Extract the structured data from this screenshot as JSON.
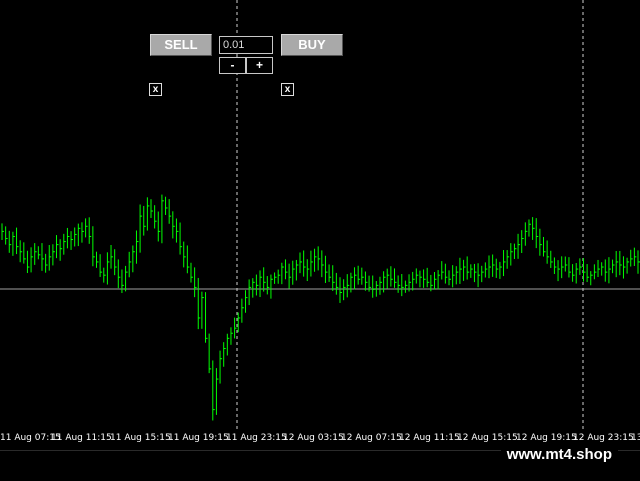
{
  "panel": {
    "sell_label": "SELL",
    "buy_label": "BUY",
    "lot_value": "0.01",
    "minus_label": "-",
    "plus_label": "+",
    "close_glyph": "x"
  },
  "chart_data": {
    "type": "bar",
    "style": "ohlc-bars",
    "color": "#00ff00",
    "background": "#000000",
    "grid": false,
    "time_labels": [
      "11 Aug 07:15",
      "11 Aug 11:15",
      "11 Aug 15:15",
      "11 Aug 19:15",
      "11 Aug 23:15",
      "12 Aug 03:15",
      "12 Aug 07:15",
      "12 Aug 11:15",
      "12 Aug 15:15",
      "12 Aug 19:15",
      "12 Aug 23:15",
      "13"
    ],
    "series": [
      {
        "values": [
          0.55,
          0.48,
          0.42,
          0.5,
          0.4,
          0.35,
          0.28,
          0.2,
          0.3,
          0.35,
          0.32,
          0.28,
          0.22,
          0.3,
          0.35,
          0.42,
          0.38,
          0.45,
          0.5,
          0.47,
          0.52,
          0.58,
          0.55,
          0.6,
          0.5,
          0.3,
          0.25,
          0.15,
          0.12,
          0.25,
          0.3,
          0.2,
          0.1,
          0.02,
          0.15,
          0.25,
          0.35,
          0.45,
          0.7,
          0.6,
          0.8,
          0.75,
          0.65,
          0.55,
          0.85,
          0.78,
          0.7,
          0.6,
          0.55,
          0.4,
          0.3,
          0.2,
          0.1,
          0.0,
          -0.3,
          -0.1,
          -0.5,
          -0.8,
          -1.2,
          -0.9,
          -0.7,
          -0.6,
          -0.5,
          -0.45,
          -0.4,
          -0.3,
          -0.2,
          -0.1,
          0.0,
          0.05,
          0.02,
          0.1,
          0.05,
          0.0,
          0.08,
          0.1,
          0.12,
          0.2,
          0.15,
          0.1,
          0.18,
          0.22,
          0.25,
          0.2,
          0.18,
          0.25,
          0.3,
          0.28,
          0.22,
          0.15,
          0.1,
          0.05,
          0.0,
          -0.05,
          0.0,
          0.02,
          0.1,
          0.12,
          0.08,
          0.1,
          0.05,
          0.0,
          -0.02,
          0.02,
          0.05,
          0.1,
          0.12,
          0.08,
          0.05,
          0.02,
          0.0,
          0.02,
          0.05,
          0.08,
          0.12,
          0.1,
          0.08,
          0.05,
          0.02,
          0.08,
          0.12,
          0.15,
          0.1,
          0.08,
          0.12,
          0.15,
          0.18,
          0.2,
          0.15,
          0.18,
          0.15,
          0.12,
          0.15,
          0.18,
          0.2,
          0.22,
          0.18,
          0.2,
          0.25,
          0.3,
          0.35,
          0.38,
          0.42,
          0.48,
          0.55,
          0.62,
          0.58,
          0.5,
          0.42,
          0.35,
          0.3,
          0.25,
          0.2,
          0.18,
          0.2,
          0.22,
          0.15,
          0.12,
          0.18,
          0.2,
          0.15,
          0.1,
          0.12,
          0.15,
          0.18,
          0.2,
          0.15,
          0.18,
          0.22,
          0.25,
          0.22,
          0.2,
          0.25,
          0.28,
          0.3,
          0.25
        ]
      }
    ]
  }
}
